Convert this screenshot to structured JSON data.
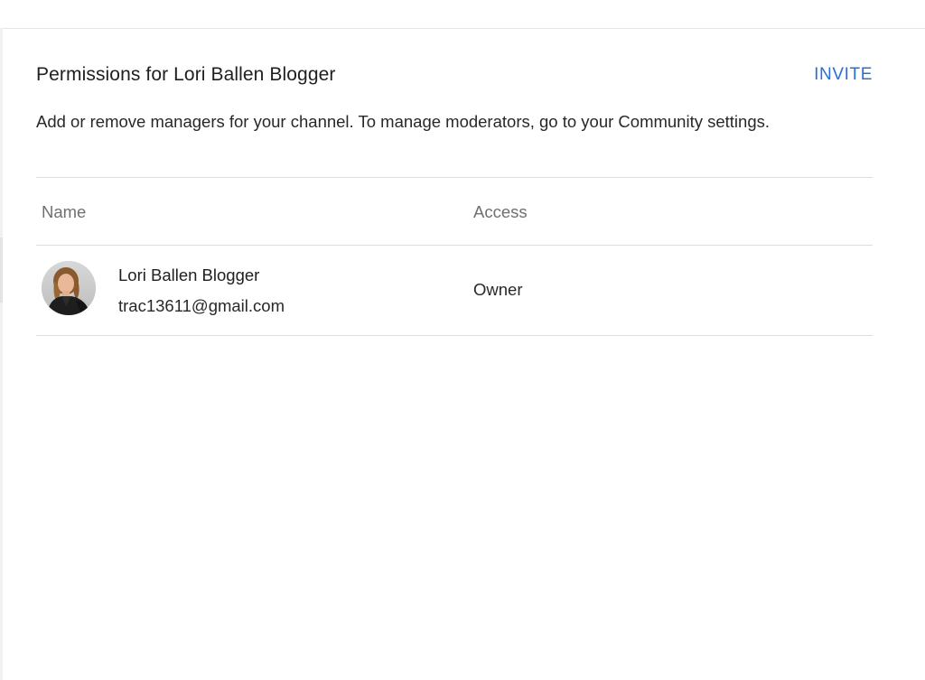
{
  "header": {
    "title": "Permissions for Lori Ballen Blogger",
    "invite_label": "INVITE"
  },
  "description": "Add or remove managers for your channel. To manage moderators, go to your Community settings.",
  "table": {
    "columns": [
      "Name",
      "Access"
    ],
    "rows": [
      {
        "name": "Lori Ballen Blogger",
        "email": "trac13611@gmail.com",
        "access": "Owner",
        "avatar_icon": "user-avatar-photo"
      }
    ]
  },
  "colors": {
    "accent": "#2a6fd6",
    "divider": "#dddddd",
    "muted_text": "#6f6f6f"
  }
}
